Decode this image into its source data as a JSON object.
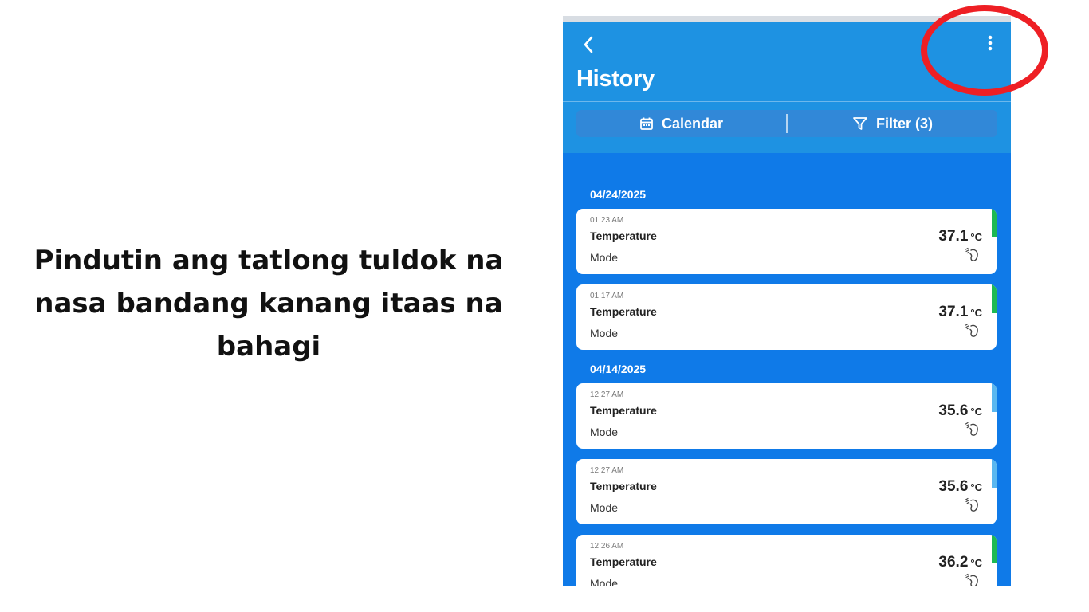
{
  "instruction": "Pindutin ang tatlong tuldok na nasa bandang kanang itaas na bahagi",
  "colors": {
    "header": "#1e92e2",
    "list_background": "#0f7ae8",
    "highlight": "#ee1f24",
    "status_green": "#1db954",
    "status_blue": "#5ab7f0"
  },
  "app": {
    "back_icon": "chevron-left-icon",
    "more_icon": "more-vertical-icon",
    "title": "History",
    "toolbar": {
      "calendar_icon": "calendar-icon",
      "calendar_label": "Calendar",
      "filter_icon": "filter-icon",
      "filter_label": "Filter (3)"
    },
    "groups": [
      {
        "date": "04/24/2025",
        "records": [
          {
            "time": "01:23 AM",
            "label": "Temperature",
            "mode": "Mode",
            "value": "37.1",
            "unit": "°C",
            "status": "green",
            "mode_icon": "forehead-icon"
          },
          {
            "time": "01:17 AM",
            "label": "Temperature",
            "mode": "Mode",
            "value": "37.1",
            "unit": "°C",
            "status": "green",
            "mode_icon": "forehead-icon"
          }
        ]
      },
      {
        "date": "04/14/2025",
        "records": [
          {
            "time": "12:27 AM",
            "label": "Temperature",
            "mode": "Mode",
            "value": "35.6",
            "unit": "°C",
            "status": "blue",
            "mode_icon": "forehead-icon"
          },
          {
            "time": "12:27 AM",
            "label": "Temperature",
            "mode": "Mode",
            "value": "35.6",
            "unit": "°C",
            "status": "blue",
            "mode_icon": "forehead-icon"
          },
          {
            "time": "12:26 AM",
            "label": "Temperature",
            "mode": "Mode",
            "value": "36.2",
            "unit": "°C",
            "status": "green",
            "mode_icon": "forehead-icon"
          }
        ]
      }
    ]
  }
}
